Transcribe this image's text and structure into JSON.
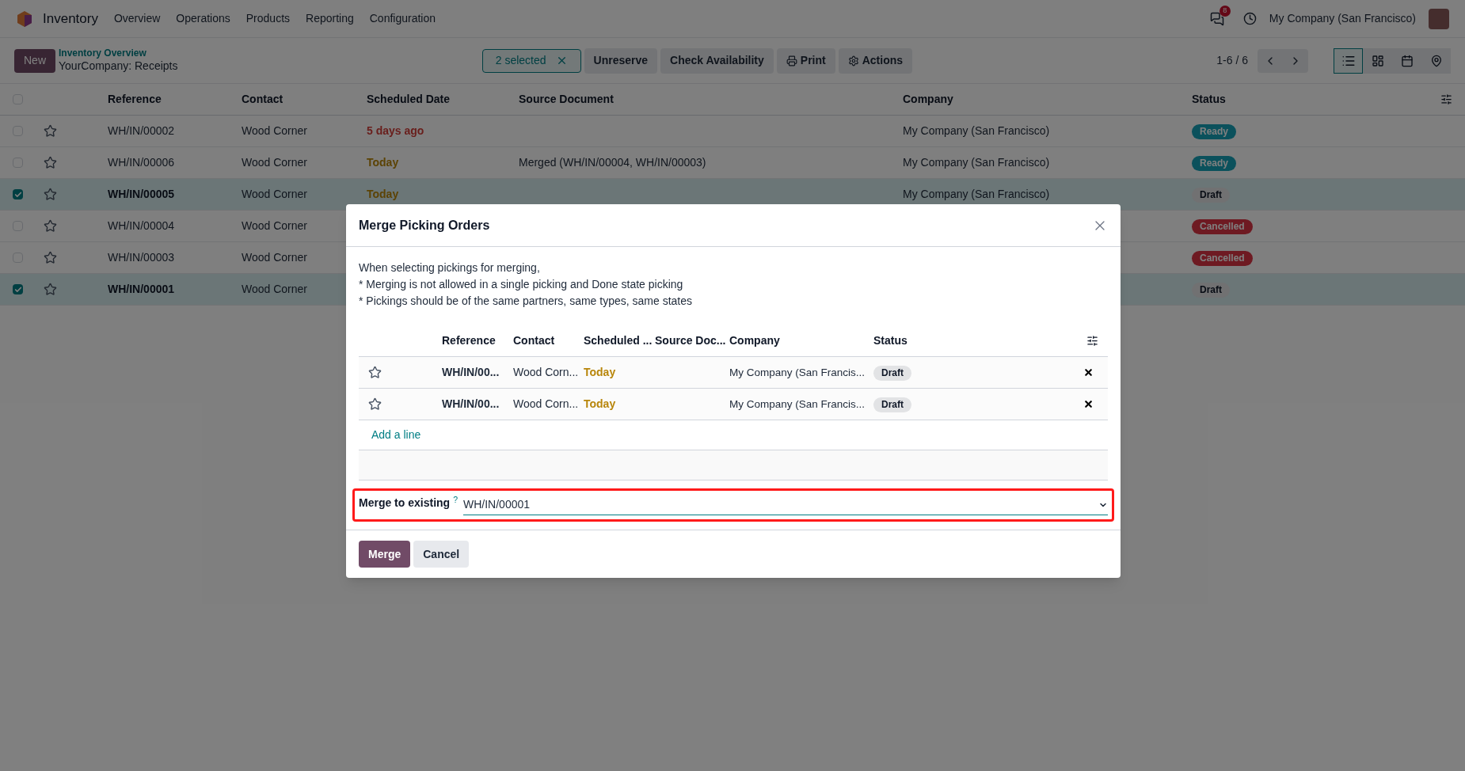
{
  "navbar": {
    "app_name": "Inventory",
    "menu": [
      "Overview",
      "Operations",
      "Products",
      "Reporting",
      "Configuration"
    ],
    "messages_badge": "8",
    "company": "My Company (San Francisco)"
  },
  "control_panel": {
    "new_button": "New",
    "breadcrumb": "Inventory Overview",
    "title": "YourCompany: Receipts",
    "selection": "2 selected",
    "actions": [
      {
        "kind": "text",
        "label": "Unreserve"
      },
      {
        "kind": "text",
        "label": "Check Availability"
      },
      {
        "kind": "print",
        "label": "Print"
      },
      {
        "kind": "gear",
        "label": "Actions"
      }
    ],
    "pager": "1-6 / 6",
    "views": [
      {
        "kind": "list",
        "selected": true
      },
      {
        "kind": "kanban",
        "selected": false
      },
      {
        "kind": "calendar",
        "selected": false
      },
      {
        "kind": "map",
        "selected": false
      }
    ]
  },
  "list": {
    "columns": [
      "Reference",
      "Contact",
      "Scheduled Date",
      "Source Document",
      "Company",
      "Status"
    ],
    "rows": [
      {
        "selected": false,
        "reference": "WH/IN/00002",
        "contact": "Wood Corner",
        "date": {
          "text": "5 days ago",
          "kind": "overdue"
        },
        "source": "",
        "company": "My Company (San Francisco)",
        "status": {
          "label": "Ready",
          "kind": "ready"
        }
      },
      {
        "selected": false,
        "reference": "WH/IN/00006",
        "contact": "Wood Corner",
        "date": {
          "text": "Today",
          "kind": "today"
        },
        "source": "Merged (WH/IN/00004, WH/IN/00003)",
        "company": "My Company (San Francisco)",
        "status": {
          "label": "Ready",
          "kind": "ready"
        }
      },
      {
        "selected": true,
        "reference": "WH/IN/00005",
        "contact": "Wood Corner",
        "date": {
          "text": "Today",
          "kind": "today"
        },
        "source": "",
        "company": "My Company (San Francisco)",
        "status": {
          "label": "Draft",
          "kind": "draft"
        }
      },
      {
        "selected": false,
        "reference": "WH/IN/00004",
        "contact": "Wood Corner",
        "status": {
          "label": "Cancelled",
          "kind": "cancelled"
        }
      },
      {
        "selected": false,
        "reference": "WH/IN/00003",
        "contact": "Wood Corner",
        "status": {
          "label": "Cancelled",
          "kind": "cancelled"
        }
      },
      {
        "selected": true,
        "reference": "WH/IN/00001",
        "contact": "Wood Corner",
        "status": {
          "label": "Draft",
          "kind": "draft"
        }
      }
    ],
    "all_selected": false
  },
  "dialog": {
    "title": "Merge Picking Orders",
    "notes": [
      "When selecting pickings for merging,",
      "* Merging is not allowed in a single picking and Done state picking",
      "* Pickings should be of the same partners, same types, same states"
    ],
    "columns": [
      "Reference",
      "Contact",
      "Scheduled ...",
      "Source Doc...",
      "Company",
      "Status"
    ],
    "rows": [
      {
        "reference": "WH/IN/00...",
        "contact": "Wood Corn...",
        "date": {
          "text": "Today",
          "kind": "today"
        },
        "company": "My Company (San Francis...",
        "status": {
          "label": "Draft",
          "kind": "draft"
        }
      },
      {
        "reference": "WH/IN/00...",
        "contact": "Wood Corn...",
        "date": {
          "text": "Today",
          "kind": "today"
        },
        "company": "My Company (San Francis...",
        "status": {
          "label": "Draft",
          "kind": "draft"
        }
      }
    ],
    "add_line": "Add a line",
    "field_label": "Merge to existing",
    "field_help": "?",
    "field_value": "WH/IN/00001",
    "buttons": [
      {
        "kind": "primary",
        "label": "Merge"
      },
      {
        "kind": "secondary",
        "label": "Cancel"
      }
    ]
  }
}
